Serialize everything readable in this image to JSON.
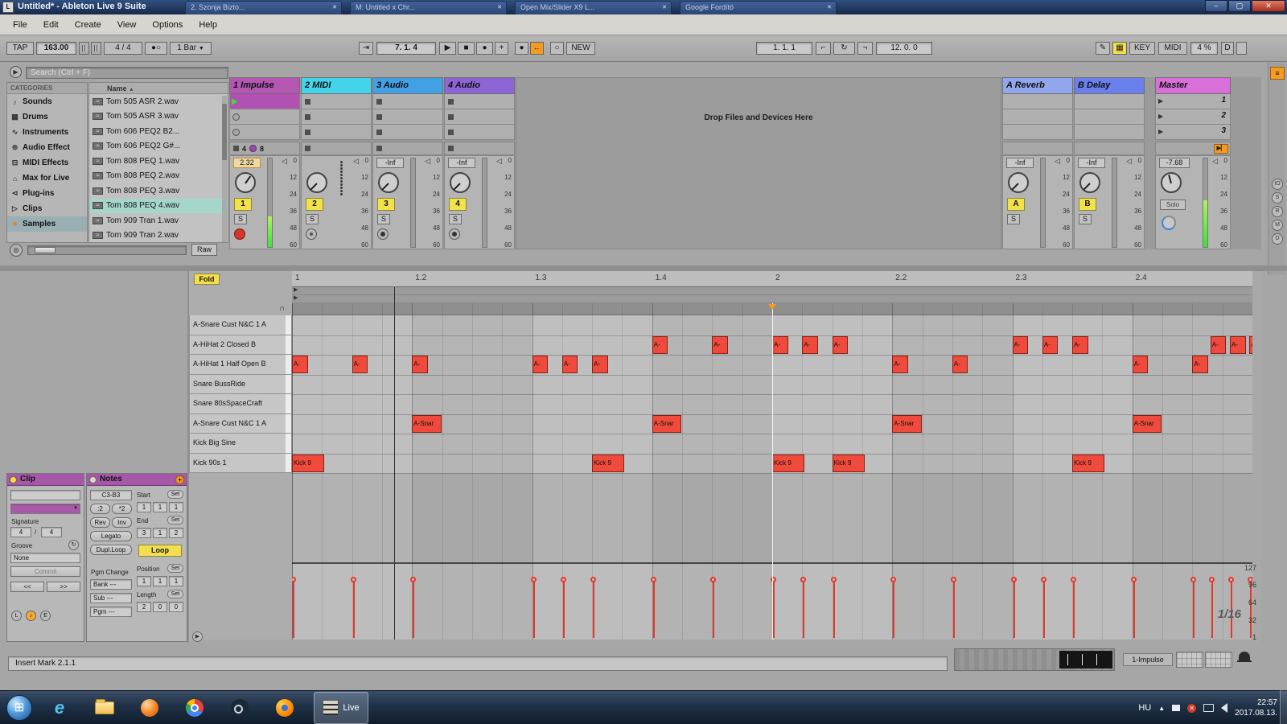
{
  "titlebar": {
    "title": "Untitled* - Ableton Live 9 Suite",
    "tabs": [
      "2. Szonja Bizto...",
      "M: Untitled x Chr...",
      "Open Mix/Slider X9 L...",
      "Google Fordító"
    ]
  },
  "menu": {
    "items": [
      "File",
      "Edit",
      "Create",
      "View",
      "Options",
      "Help"
    ]
  },
  "icons": {
    "play": "▶",
    "stop": "■",
    "record": "●",
    "plus": "+",
    "follow": "⇥",
    "back_arrow": "←",
    "circle": "○",
    "pencil": "✎",
    "keyboard": "▦",
    "loop": "↻",
    "punch_in": "⌐",
    "punch_out": "¬",
    "dropdown": "▼",
    "sort_up": "▲",
    "speaker": "◁",
    "metronome": "○",
    "cue": "●",
    "headphone": "∩",
    "search": "◎",
    "close": "✕",
    "min": "–",
    "max": "▢",
    "groove": "↻",
    "fold_play": "▶",
    "back_to_arr": "▶▏",
    "wave": "≈"
  },
  "transport": {
    "tap": "TAP",
    "tempo": "163.00",
    "signature": "4 / 4",
    "quantize": "1 Bar",
    "arrangement_position": "7. 1. 4",
    "new_label": "NEW",
    "loop_start": "1. 1. 1",
    "loop_length": "12. 0. 0",
    "key_label": "KEY",
    "midi_label": "MIDI",
    "cpu": "4 %",
    "overdub": "D"
  },
  "browser": {
    "search_placeholder": "Search (Ctrl + F)",
    "categories_header": "CATEGORIES",
    "categories": [
      {
        "label": "Sounds",
        "glyph": "♪"
      },
      {
        "label": "Drums",
        "glyph": "▦"
      },
      {
        "label": "Instruments",
        "glyph": "∿"
      },
      {
        "label": "Audio Effect",
        "glyph": "⊜"
      },
      {
        "label": "MIDI Effects",
        "glyph": "⊟"
      },
      {
        "label": "Max for Live",
        "glyph": "⌂"
      },
      {
        "label": "Plug-ins",
        "glyph": "⊲"
      },
      {
        "label": "Clips",
        "glyph": "▷"
      },
      {
        "label": "Samples",
        "glyph": "∗"
      }
    ],
    "selected_category": "Samples",
    "files_header": "Name",
    "files": [
      "Tom 505 ASR 2.wav",
      "Tom 505 ASR 3.wav",
      "Tom 606 PEQ2 B2...",
      "Tom 606 PEQ2 G#...",
      "Tom 808 PEQ 1.wav",
      "Tom 808 PEQ 2.wav",
      "Tom 808 PEQ 3.wav",
      "Tom 808 PEQ 4.wav",
      "Tom 909 Tran 1.wav",
      "Tom 909 Tran 2.wav"
    ],
    "selected_file_index": 7,
    "raw_label": "Raw"
  },
  "session": {
    "drop_hint": "Drop Files and Devices Here",
    "scene_numbers": [
      "1",
      "2",
      "3"
    ],
    "db_scale": [
      "0",
      "12",
      "24",
      "36",
      "48",
      "60"
    ],
    "solo_abbrev": "S",
    "status_numbers": {
      "left": "4",
      "right": "8"
    },
    "side_toggles": [
      "IO",
      "S",
      "R",
      "M",
      "D"
    ],
    "tracks": [
      {
        "name": "1 Impulse",
        "color": "#b357b3",
        "activator": "1",
        "value": "2.32",
        "kind": "impulse"
      },
      {
        "name": "2 MIDI",
        "color": "#43d3ea",
        "activator": "2",
        "value": "",
        "kind": "midi"
      },
      {
        "name": "3 Audio",
        "color": "#42a1e4",
        "activator": "3",
        "value": "-Inf",
        "kind": "audio"
      },
      {
        "name": "4 Audio",
        "color": "#8e65d5",
        "activator": "4",
        "value": "-Inf",
        "kind": "audio"
      }
    ],
    "returns": [
      {
        "name": "A Reverb",
        "color": "#91a6ec",
        "activator": "A",
        "value": "-Inf"
      },
      {
        "name": "B Delay",
        "color": "#6a80ec",
        "activator": "B",
        "value": "-Inf"
      }
    ],
    "master": {
      "name": "Master",
      "color": "#d96fd9",
      "value": "-7.68",
      "solo_label": "Solo"
    }
  },
  "midi": {
    "fold_label": "Fold",
    "ruler": [
      {
        "beat": 0,
        "label": "1"
      },
      {
        "beat": 1,
        "label": "1.2"
      },
      {
        "beat": 2,
        "label": "1.3"
      },
      {
        "beat": 3,
        "label": "1.4"
      },
      {
        "beat": 4,
        "label": "2"
      },
      {
        "beat": 5,
        "label": "2.2"
      },
      {
        "beat": 6,
        "label": "2.3"
      },
      {
        "beat": 7,
        "label": "2.4"
      }
    ],
    "rows": [
      "A-Snare Cust N&C 1 A",
      "A-HiHat 2 Closed B",
      "A-HiHat 1 Half Open B",
      "Snare BussRide",
      "Snare 80sSpaceCraft",
      "A-Snare Cust N&C 1 A",
      "Kick Big Sine",
      "Kick 90s 1"
    ],
    "notes": [
      {
        "row": 1,
        "label": "A-",
        "width_steps": 0.55,
        "steps": [
          12,
          14,
          16,
          17,
          18,
          24,
          25,
          26,
          30.6,
          31.25,
          31.9
        ]
      },
      {
        "row": 2,
        "label": "A-",
        "width_steps": 0.55,
        "steps": [
          0,
          2,
          4,
          8,
          9,
          10,
          20,
          22,
          28,
          30
        ]
      },
      {
        "row": 5,
        "label": "A-Snar",
        "width_steps": 1.0,
        "steps": [
          4,
          12,
          20,
          28
        ]
      },
      {
        "row": 7,
        "label": "Kick 9",
        "width_steps": 1.1,
        "steps": [
          0,
          10,
          16,
          18,
          26
        ]
      }
    ],
    "velocity_value": 100,
    "velocity_scale": [
      "127",
      "96",
      "64",
      "32",
      "1"
    ],
    "grid_value": "1/16",
    "playhead_beat": 4,
    "insert_mark_beat": 0.85,
    "beats": 8,
    "steps_per_beat": 4
  },
  "clip_panel": {
    "title": "Clip",
    "signature_label": "Signature",
    "sig_a": "4",
    "sig_sep": "/",
    "sig_b": "4",
    "groove_label": "Groove",
    "groove_value": "None",
    "commit": "Commit",
    "nudge_left": "<<",
    "nudge_right": ">>",
    "footer_circles": [
      "L",
      "♪",
      "E"
    ]
  },
  "notes_panel": {
    "title": "Notes",
    "range": "C3-B3",
    "half": ":2",
    "double": "*2",
    "rev": "Rev",
    "inv": "Inv",
    "legato": "Legato",
    "dupl": "Dupl.Loop",
    "start_label": "Start",
    "set": "Set",
    "start_vals": [
      "1",
      "1",
      "1"
    ],
    "end_label": "End",
    "end_vals": [
      "3",
      "1",
      "2"
    ],
    "loop_label": "Loop",
    "pgm_label": "Pgm Change",
    "bank": "Bank ---",
    "sub": "Sub ---",
    "pgm": "Pgm ---",
    "position_label": "Position",
    "pos_vals": [
      "1",
      "1",
      "1"
    ],
    "length_label": "Length",
    "len_vals": [
      "2",
      "0",
      "0"
    ]
  },
  "status_bar": {
    "text": "Insert Mark 2.1.1"
  },
  "footer": {
    "clip_button": "1-Impulse"
  },
  "taskbar": {
    "live_label": "Live",
    "lang": "HU",
    "time": "22:57",
    "date": "2017.08.13."
  }
}
